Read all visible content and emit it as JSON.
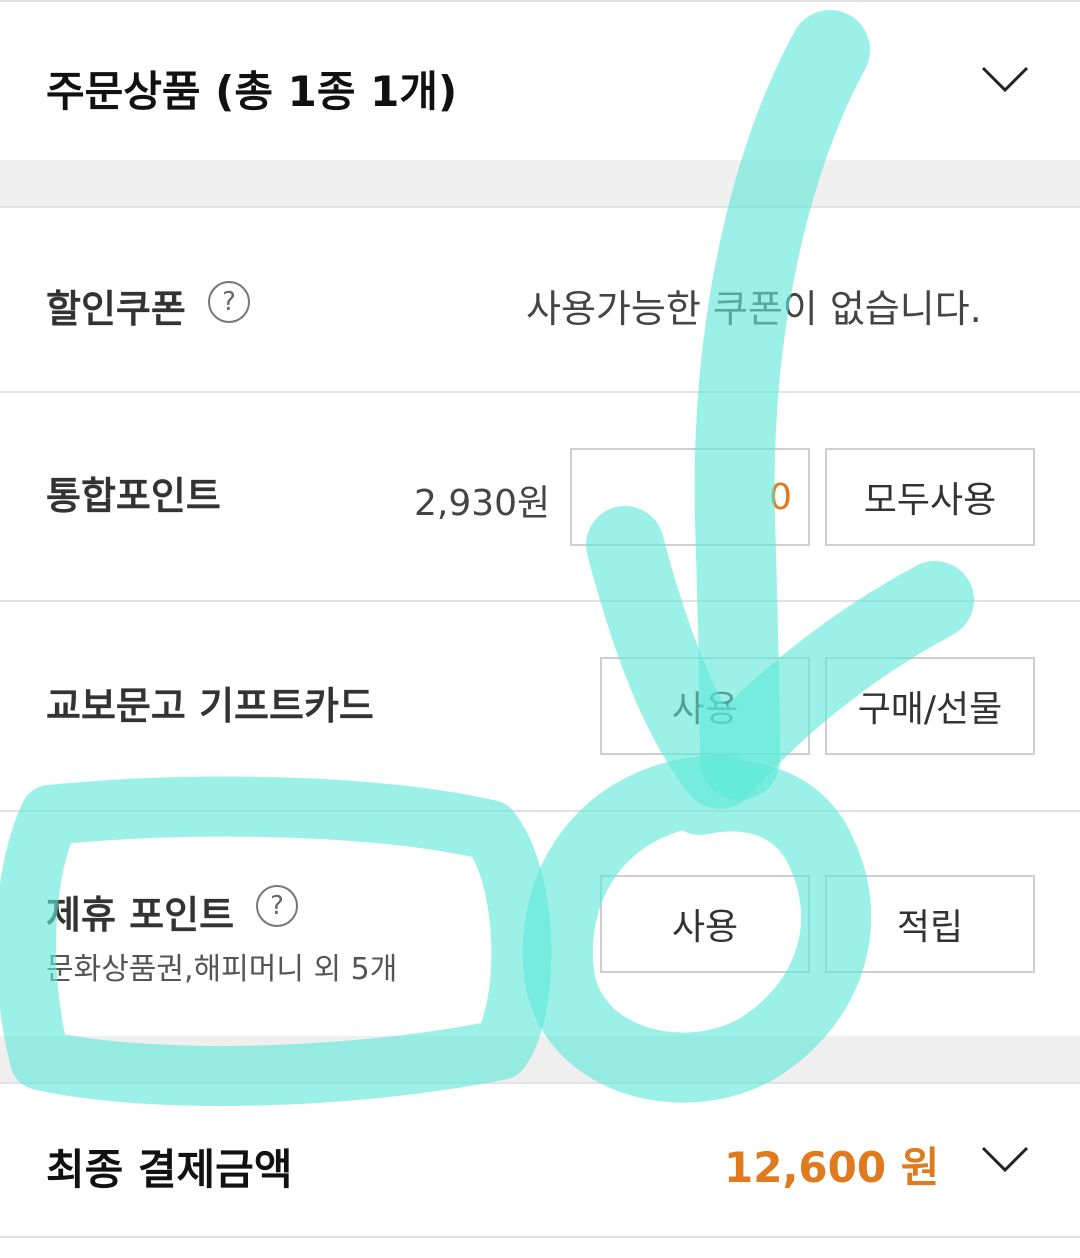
{
  "order_products": {
    "title": "주문상품 (총 1종 1개)",
    "toggle_icon": "chevron-down-icon"
  },
  "coupon": {
    "label": "할인쿠폰",
    "help_icon": "question-circle-icon",
    "help_glyph": "?",
    "status": "사용가능한 쿠폰이 없습니다."
  },
  "integrated_points": {
    "label": "통합포인트",
    "balance": "2,930원",
    "input_value": "0",
    "use_all_label": "모두사용"
  },
  "gift_card": {
    "label": "교보문고 기프트카드",
    "use_label": "사용",
    "buy_gift_label": "구매/선물"
  },
  "partner_points": {
    "label": "제휴 포인트",
    "help_glyph": "?",
    "sub_label": "문화상품권,해피머니 외 5개",
    "use_label": "사용",
    "earn_label": "적립"
  },
  "final_payment": {
    "label": "최종 결제금액",
    "amount": "12,600 원",
    "toggle_icon": "chevron-down-icon"
  },
  "colors": {
    "accent_orange": "#e07a1f",
    "annotation": "#5ee8d8",
    "divider": "#e2e2e2",
    "band": "#efefef"
  }
}
